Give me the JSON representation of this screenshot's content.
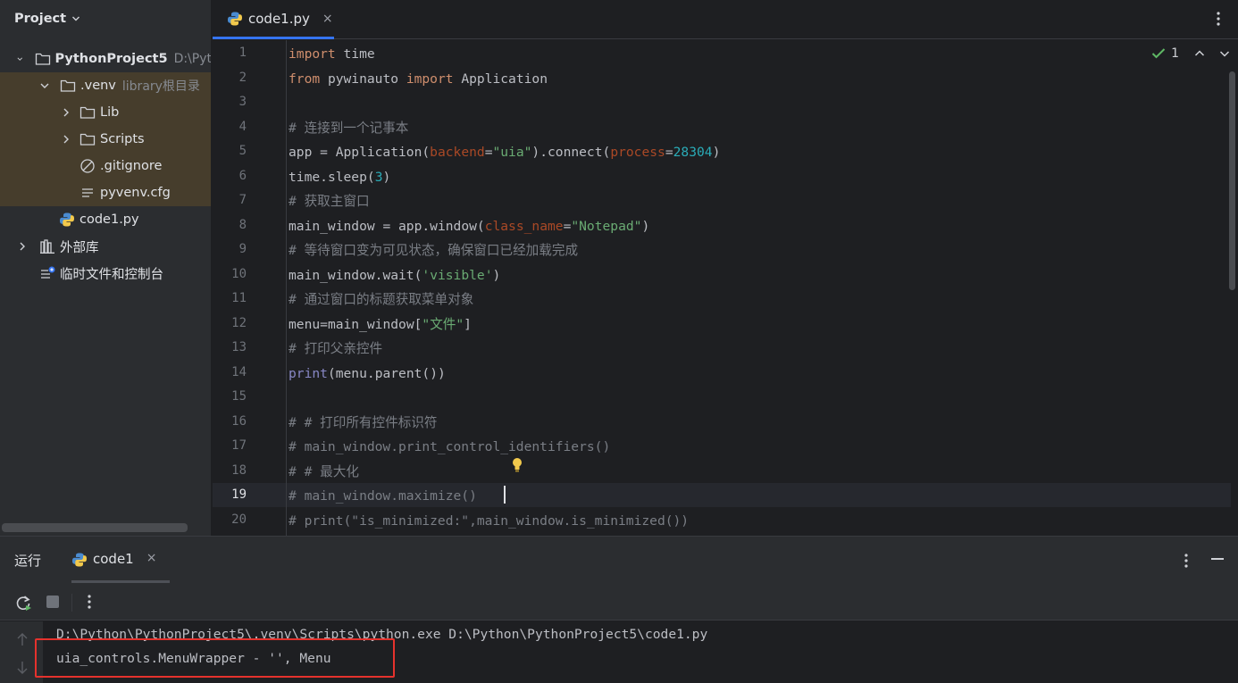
{
  "project": {
    "title": "Project",
    "tree": [
      {
        "name": "PythonProject5",
        "hint": "D:\\Pyt",
        "type": "folder",
        "expanded": true
      },
      {
        "name": ".venv",
        "hint": "library根目录",
        "type": "folder",
        "expanded": true
      },
      {
        "name": "Lib",
        "type": "folder",
        "expanded": false
      },
      {
        "name": "Scripts",
        "type": "folder",
        "expanded": false
      },
      {
        "name": ".gitignore",
        "type": "ignore-file"
      },
      {
        "name": "pyvenv.cfg",
        "type": "config-file"
      },
      {
        "name": "code1.py",
        "type": "python-file"
      },
      {
        "name": "外部库",
        "type": "library",
        "expanded": false
      },
      {
        "name": "临时文件和控制台",
        "type": "scratches"
      }
    ]
  },
  "editor": {
    "tab": {
      "label": "code1.py",
      "close": "×"
    },
    "inspection": {
      "count": "1"
    },
    "current_line": 19,
    "line_numbers": [
      "1",
      "2",
      "3",
      "4",
      "5",
      "6",
      "7",
      "8",
      "9",
      "10",
      "11",
      "12",
      "13",
      "14",
      "15",
      "16",
      "17",
      "18",
      "19",
      "20"
    ],
    "lines": [
      "import time",
      "from pywinauto import Application",
      "",
      "# 连接到一个记事本",
      "app = Application(backend=\"uia\").connect(process=28304)",
      "time.sleep(3)",
      "# 获取主窗口",
      "main_window = app.window(class_name=\"Notepad\")",
      "# 等待窗口变为可见状态，确保窗口已经加载完成",
      "main_window.wait('visible')",
      "# 通过窗口的标题获取菜单对象",
      "menu=main_window[\"文件\"]",
      "# 打印父亲控件",
      "print(menu.parent())",
      "",
      "# # 打印所有控件标识符",
      "# main_window.print_control_identifiers()",
      "# # 最大化",
      "# main_window.maximize()",
      "# print(\"is_minimized:\",main_window.is_minimized())"
    ]
  },
  "run": {
    "title": "运行",
    "tab": {
      "label": "code1",
      "close": "×"
    },
    "console": [
      "D:\\Python\\PythonProject5\\.venv\\Scripts\\python.exe D:\\Python\\PythonProject5\\code1.py",
      "uia_controls.MenuWrapper - '', Menu"
    ],
    "highlighted_line": 2
  },
  "colors": {
    "keyword": "#cf8e6d",
    "string": "#6aab73",
    "number": "#2aacb8",
    "parameter": "#aa4926",
    "comment": "#7a7e85",
    "builtin": "#8888c6",
    "accent": "#3574f0",
    "highlight_box": "#e5322d",
    "venv_highlight": "#463d2c"
  }
}
